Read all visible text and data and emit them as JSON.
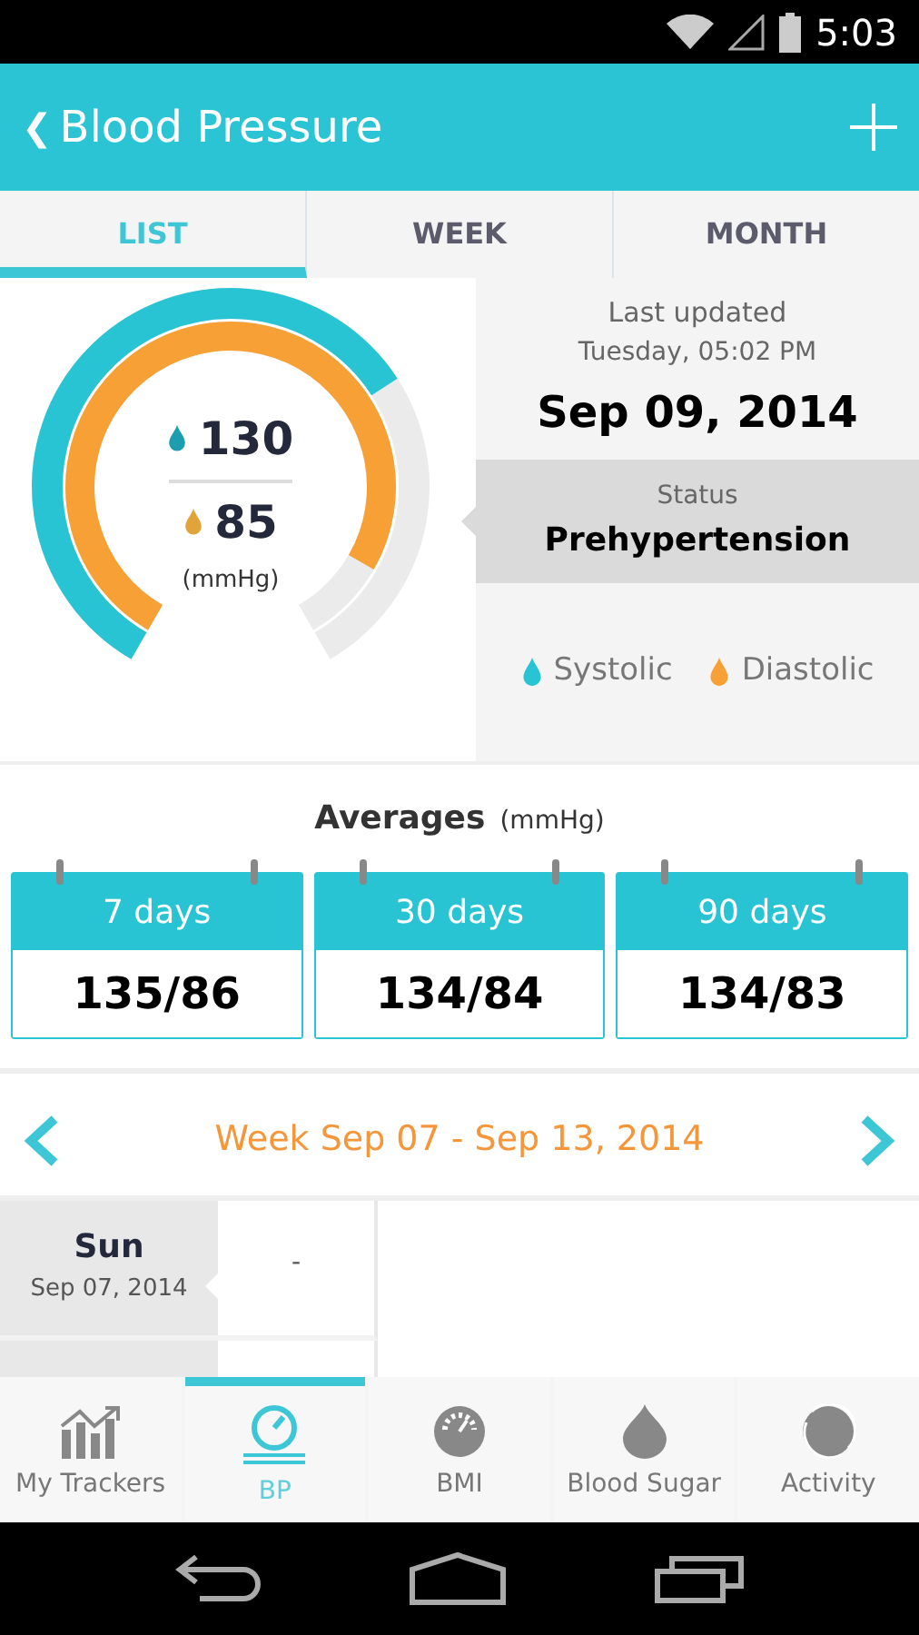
{
  "status_bar": {
    "time": "5:03"
  },
  "header": {
    "back": "❮",
    "title": "Blood Pressure"
  },
  "tabs": [
    {
      "label": "LIST",
      "selected": true
    },
    {
      "label": "WEEK",
      "selected": false
    },
    {
      "label": "MONTH",
      "selected": false
    }
  ],
  "gauge": {
    "systolic": {
      "value": "130"
    },
    "diastolic": {
      "value": "85"
    },
    "unit": "(mmHg)"
  },
  "summary": {
    "last_updated": "Last updated",
    "time": "Tuesday, 05:02 PM",
    "date": "Sep 09, 2014",
    "status_label": "Status",
    "status": "Prehypertension"
  },
  "legend": [
    {
      "label": "Systolic",
      "color": "#29c4d4"
    },
    {
      "label": "Diastolic",
      "color": "#f7a035"
    }
  ],
  "averages": {
    "title": "Averages",
    "unit": "(mmHg)",
    "cards": [
      {
        "label": "7 days",
        "value": "135/86"
      },
      {
        "label": "30 days",
        "value": "134/84"
      },
      {
        "label": "90 days",
        "value": "134/83"
      }
    ]
  },
  "week": {
    "label": "Week Sep 07 - Sep 13, 2014"
  },
  "days": [
    {
      "day": "Sun",
      "date": "Sep 07, 2014",
      "reading": "-",
      "selected": true
    }
  ],
  "nav": [
    {
      "label": "My Trackers",
      "kind": "chart",
      "selected": false
    },
    {
      "label": "BP",
      "kind": "gauge",
      "selected": true
    },
    {
      "label": "BMI",
      "kind": "meter",
      "selected": false
    },
    {
      "label": "Blood Sugar",
      "kind": "drop",
      "selected": false
    },
    {
      "label": "Activity",
      "kind": "ball",
      "selected": false
    }
  ]
}
